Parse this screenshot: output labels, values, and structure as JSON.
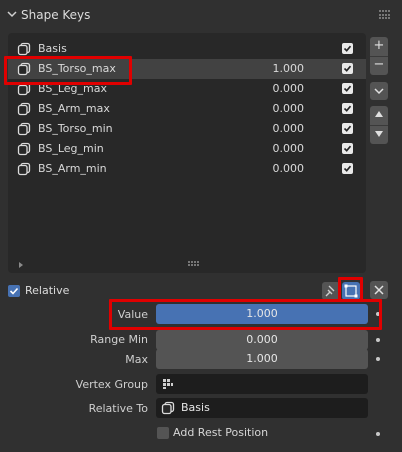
{
  "panel": {
    "title": "Shape Keys"
  },
  "shape_keys": [
    {
      "name": "Basis",
      "value": "",
      "enabled": true,
      "selected": false
    },
    {
      "name": "BS_Torso_max",
      "value": "1.000",
      "enabled": true,
      "selected": true
    },
    {
      "name": "BS_Leg_max",
      "value": "0.000",
      "enabled": true,
      "selected": false
    },
    {
      "name": "BS_Arm_max",
      "value": "0.000",
      "enabled": true,
      "selected": false
    },
    {
      "name": "BS_Torso_min",
      "value": "0.000",
      "enabled": true,
      "selected": false
    },
    {
      "name": "BS_Leg_min",
      "value": "0.000",
      "enabled": true,
      "selected": false
    },
    {
      "name": "BS_Arm_min",
      "value": "0.000",
      "enabled": true,
      "selected": false
    }
  ],
  "side_buttons": {
    "add": "+",
    "remove": "−"
  },
  "relative": {
    "label": "Relative",
    "checked": true
  },
  "props": {
    "value_label": "Value",
    "value": "1.000",
    "value_fraction": 1.0,
    "range_min_label": "Range Min",
    "range_min": "0.000",
    "max_label": "Max",
    "max": "1.000",
    "vertex_group_label": "Vertex Group",
    "vertex_group": "",
    "relative_to_label": "Relative To",
    "relative_to": "Basis",
    "add_rest_label": "Add Rest Position",
    "add_rest_checked": false
  },
  "colors": {
    "accent": "#4772b3",
    "highlight": "#e00000",
    "panel": "#303030"
  }
}
